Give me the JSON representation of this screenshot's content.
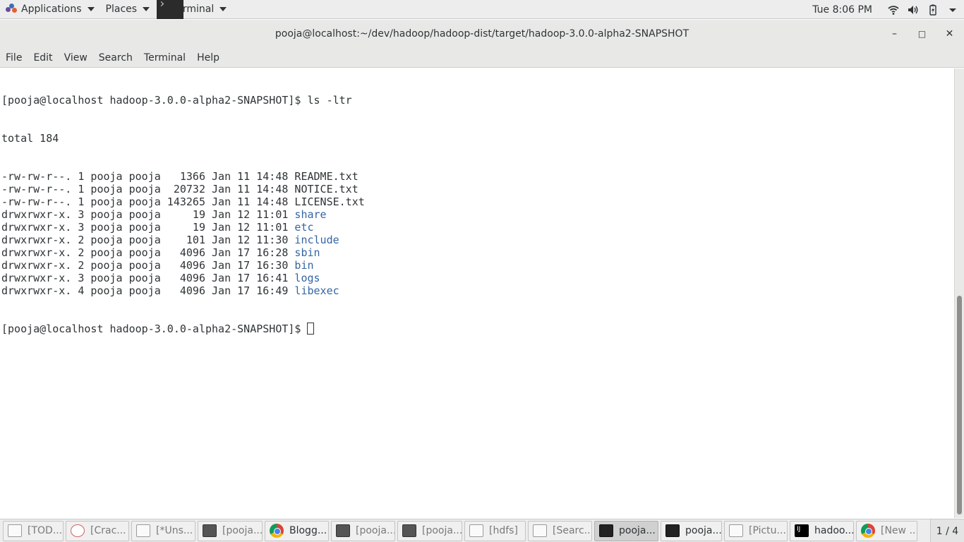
{
  "topbar": {
    "applications_label": "Applications",
    "places_label": "Places",
    "terminal_label": "Terminal",
    "clock": "Tue  8:06 PM"
  },
  "window": {
    "title": "pooja@localhost:~/dev/hadoop/hadoop-dist/target/hadoop-3.0.0-alpha2-SNAPSHOT",
    "minimize": "–",
    "maximize": "□",
    "close": "✕"
  },
  "menubar": {
    "items": [
      "File",
      "Edit",
      "View",
      "Search",
      "Terminal",
      "Help"
    ]
  },
  "terminal": {
    "prompt_cmd": "[pooja@localhost hadoop-3.0.0-alpha2-SNAPSHOT]$ ls -ltr",
    "total": "total 184",
    "entries": [
      {
        "meta": "-rw-rw-r--. 1 pooja pooja   1366 Jan 11 14:48 ",
        "name": "README.txt",
        "is_dir": false
      },
      {
        "meta": "-rw-rw-r--. 1 pooja pooja  20732 Jan 11 14:48 ",
        "name": "NOTICE.txt",
        "is_dir": false
      },
      {
        "meta": "-rw-rw-r--. 1 pooja pooja 143265 Jan 11 14:48 ",
        "name": "LICENSE.txt",
        "is_dir": false
      },
      {
        "meta": "drwxrwxr-x. 3 pooja pooja     19 Jan 12 11:01 ",
        "name": "share",
        "is_dir": true
      },
      {
        "meta": "drwxrwxr-x. 3 pooja pooja     19 Jan 12 11:01 ",
        "name": "etc",
        "is_dir": true
      },
      {
        "meta": "drwxrwxr-x. 2 pooja pooja    101 Jan 12 11:30 ",
        "name": "include",
        "is_dir": true
      },
      {
        "meta": "drwxrwxr-x. 2 pooja pooja   4096 Jan 17 16:28 ",
        "name": "sbin",
        "is_dir": true
      },
      {
        "meta": "drwxrwxr-x. 2 pooja pooja   4096 Jan 17 16:30 ",
        "name": "bin",
        "is_dir": true
      },
      {
        "meta": "drwxrwxr-x. 3 pooja pooja   4096 Jan 17 16:41 ",
        "name": "logs",
        "is_dir": true
      },
      {
        "meta": "drwxrwxr-x. 4 pooja pooja   4096 Jan 17 16:49 ",
        "name": "libexec",
        "is_dir": true
      }
    ],
    "final_prompt": "[pooja@localhost hadoop-3.0.0-alpha2-SNAPSHOT]$ ",
    "dir_color": "#3465a4",
    "text_color": "#2e3436"
  },
  "taskbar": {
    "tasks": [
      {
        "label": "[TOD...",
        "icon": "document-icon",
        "active": false
      },
      {
        "label": "[Crac...",
        "icon": "java-icon",
        "active": false
      },
      {
        "label": "[*Uns...",
        "icon": "text-editor-icon",
        "active": false
      },
      {
        "label": "[pooja...",
        "icon": "terminal-icon",
        "active": false
      },
      {
        "label": "Blogg...",
        "icon": "chrome-icon",
        "active": false,
        "bold": true
      },
      {
        "label": "[pooja...",
        "icon": "terminal-icon",
        "active": false
      },
      {
        "label": "[pooja...",
        "icon": "terminal-icon",
        "active": false
      },
      {
        "label": "[hdfs]",
        "icon": "document-icon",
        "active": false
      },
      {
        "label": "[Searc...",
        "icon": "document-icon",
        "active": false
      },
      {
        "label": "pooja...",
        "icon": "terminal-icon",
        "active": true
      },
      {
        "label": "pooja...",
        "icon": "terminal-icon",
        "active": false,
        "bold": true
      },
      {
        "label": "[Pictu...",
        "icon": "document-icon",
        "active": false
      },
      {
        "label": "hadoo...",
        "icon": "intellij-icon",
        "active": false,
        "bold": true
      },
      {
        "label": "[New ...",
        "icon": "chrome-icon",
        "active": false
      }
    ],
    "workspace": "1 / 4"
  }
}
